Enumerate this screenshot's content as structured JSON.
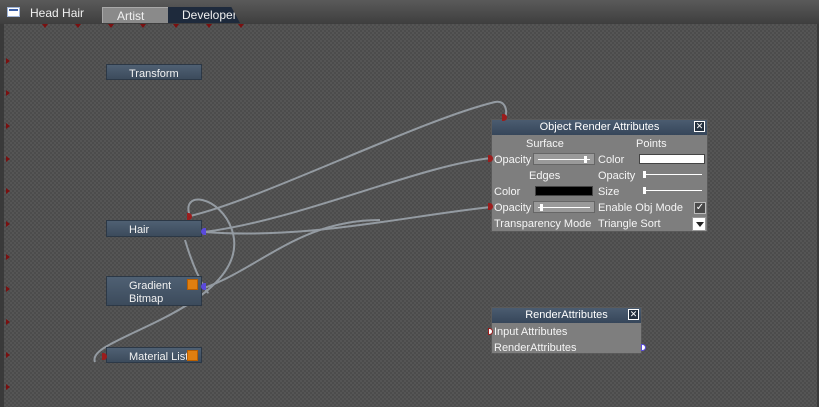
{
  "window": {
    "title": "Head Hair"
  },
  "tabs": [
    {
      "label": "Artist",
      "active": true
    },
    {
      "label": "Developer",
      "active": false
    }
  ],
  "nodes": {
    "transform": {
      "label": "Transform"
    },
    "hair": {
      "label": "Hair"
    },
    "gradient_bitmap": {
      "label_line1": "Gradient",
      "label_line2": "Bitmap"
    },
    "material_list": {
      "label": "Material List"
    }
  },
  "object_render_attributes": {
    "title": "Object Render Attributes",
    "surface_header": "Surface",
    "points_header": "Points",
    "edges_header": "Edges",
    "surface_opacity_label": "Opacity",
    "points_color_label": "Color",
    "points_color_value": "#ffffff",
    "points_opacity_label": "Opacity",
    "edges_color_label": "Color",
    "edges_color_value": "#000000",
    "points_size_label": "Size",
    "edges_opacity_label": "Opacity",
    "enable_obj_mode_label": "Enable Obj Mode",
    "enable_obj_mode_checked": true,
    "transparency_mode_label": "Transparency Mode",
    "transparency_mode_value": "Triangle Sort"
  },
  "render_attributes": {
    "title": "RenderAttributes",
    "input_label": "Input Attributes",
    "output_label": "RenderAttributes"
  },
  "icons": {
    "close": "close-icon",
    "check": "checkmark-icon",
    "dropdown": "chevron-down-icon",
    "window": "window-icon"
  },
  "colors": {
    "node_bg": "#46566a",
    "panel_bg": "#7e7e7e",
    "port_in": "#9b1d1d",
    "port_out": "#5a4adb",
    "accent": "#e07f10",
    "wire": "#a0a8b0"
  }
}
